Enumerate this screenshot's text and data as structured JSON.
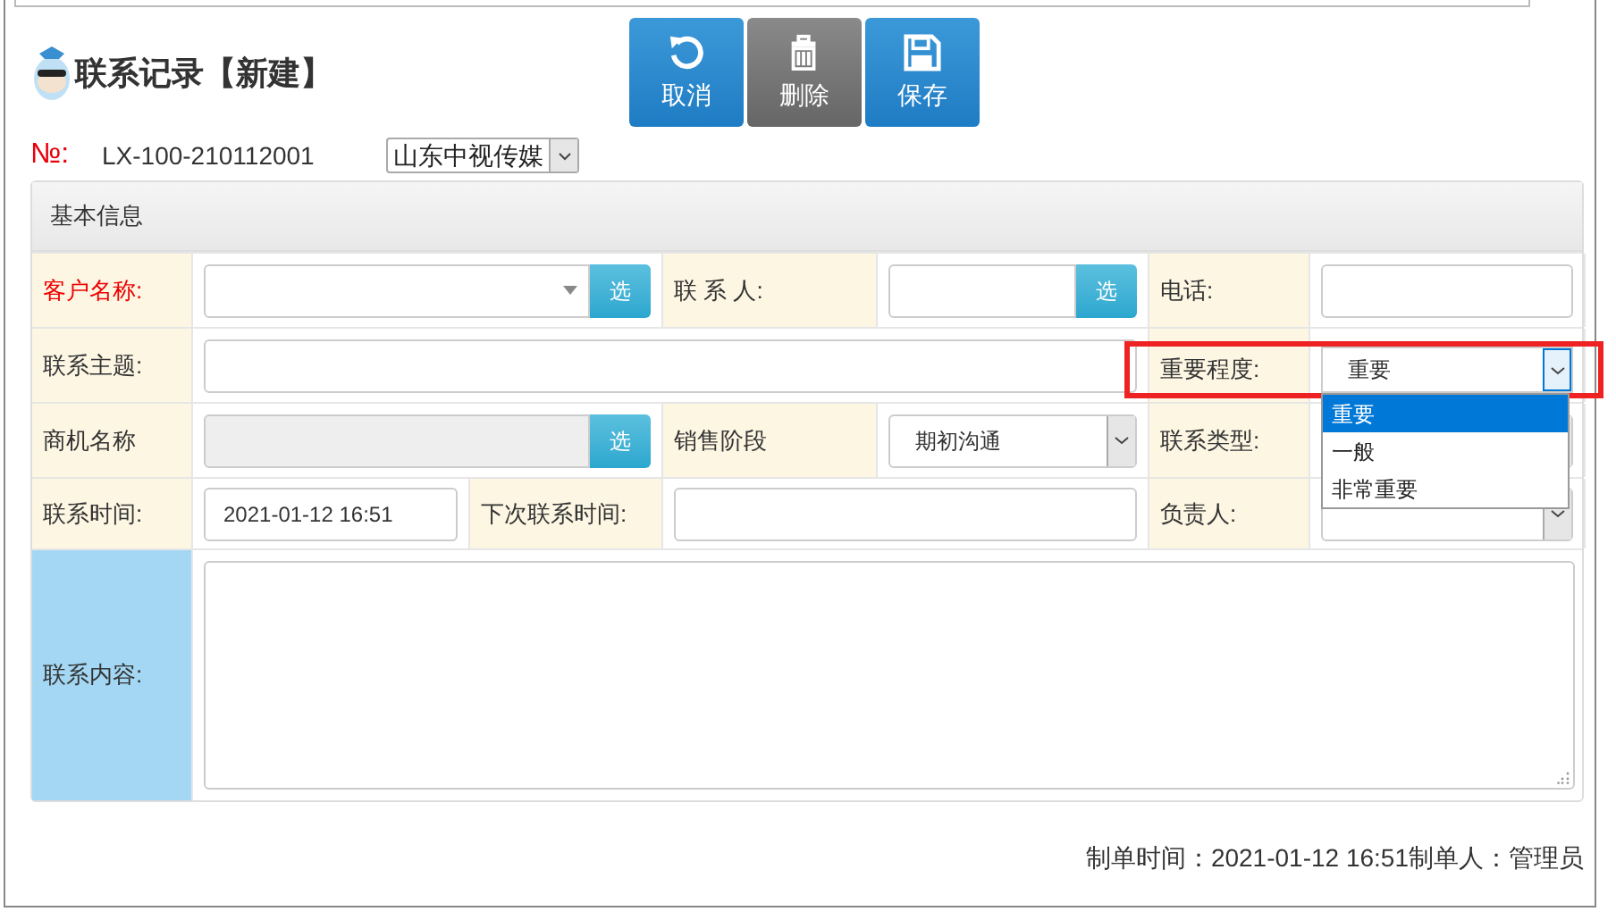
{
  "title": "联系记录【新建】",
  "toolbar": [
    {
      "label": "取消",
      "kind": "undo"
    },
    {
      "label": "删除",
      "kind": "delete"
    },
    {
      "label": "保存",
      "kind": "save"
    }
  ],
  "number": {
    "label": "№:",
    "value": "LX-100-210112001"
  },
  "company_select": {
    "value": "山东中视传媒"
  },
  "section": {
    "title": "基本信息"
  },
  "rows": [
    {
      "fields": [
        {
          "label": "客户名称:",
          "required": true,
          "kind": "combo_pick",
          "button": "选"
        },
        {
          "label": "联 系 人:",
          "required": false,
          "kind": "text_pick",
          "button": "选"
        },
        {
          "label": "电话:",
          "required": false,
          "kind": "text"
        }
      ]
    },
    {
      "fields": [
        {
          "label": "联系主题:",
          "required": false,
          "kind": "text"
        },
        {
          "label": "重要程度:",
          "required": false,
          "kind": "select",
          "value": "重要",
          "highlighted": true,
          "open": true,
          "options": [
            {
              "label": "重要",
              "selected": true
            },
            {
              "label": "一般",
              "selected": false
            },
            {
              "label": "非常重要",
              "selected": false
            }
          ]
        }
      ]
    },
    {
      "fields": [
        {
          "label": "商机名称",
          "required": false,
          "kind": "disabled_pick",
          "button": "选"
        },
        {
          "label": "销售阶段",
          "required": false,
          "kind": "select",
          "value": "期初沟通"
        },
        {
          "label": "联系类型:",
          "required": false,
          "kind": "select"
        }
      ]
    },
    {
      "fields": [
        {
          "label": "联系时间:",
          "required": false,
          "kind": "text",
          "value": "2021-01-12 16:51"
        },
        {
          "label": "下次联系时间:",
          "required": false,
          "kind": "text"
        },
        {
          "label": "负责人:",
          "required": false,
          "kind": "select"
        }
      ]
    },
    {
      "fields": [
        {
          "label": "联系内容:",
          "required": false,
          "kind": "textarea"
        }
      ]
    }
  ],
  "footer": "制单时间：2021-01-12 16:51制单人：管理员"
}
